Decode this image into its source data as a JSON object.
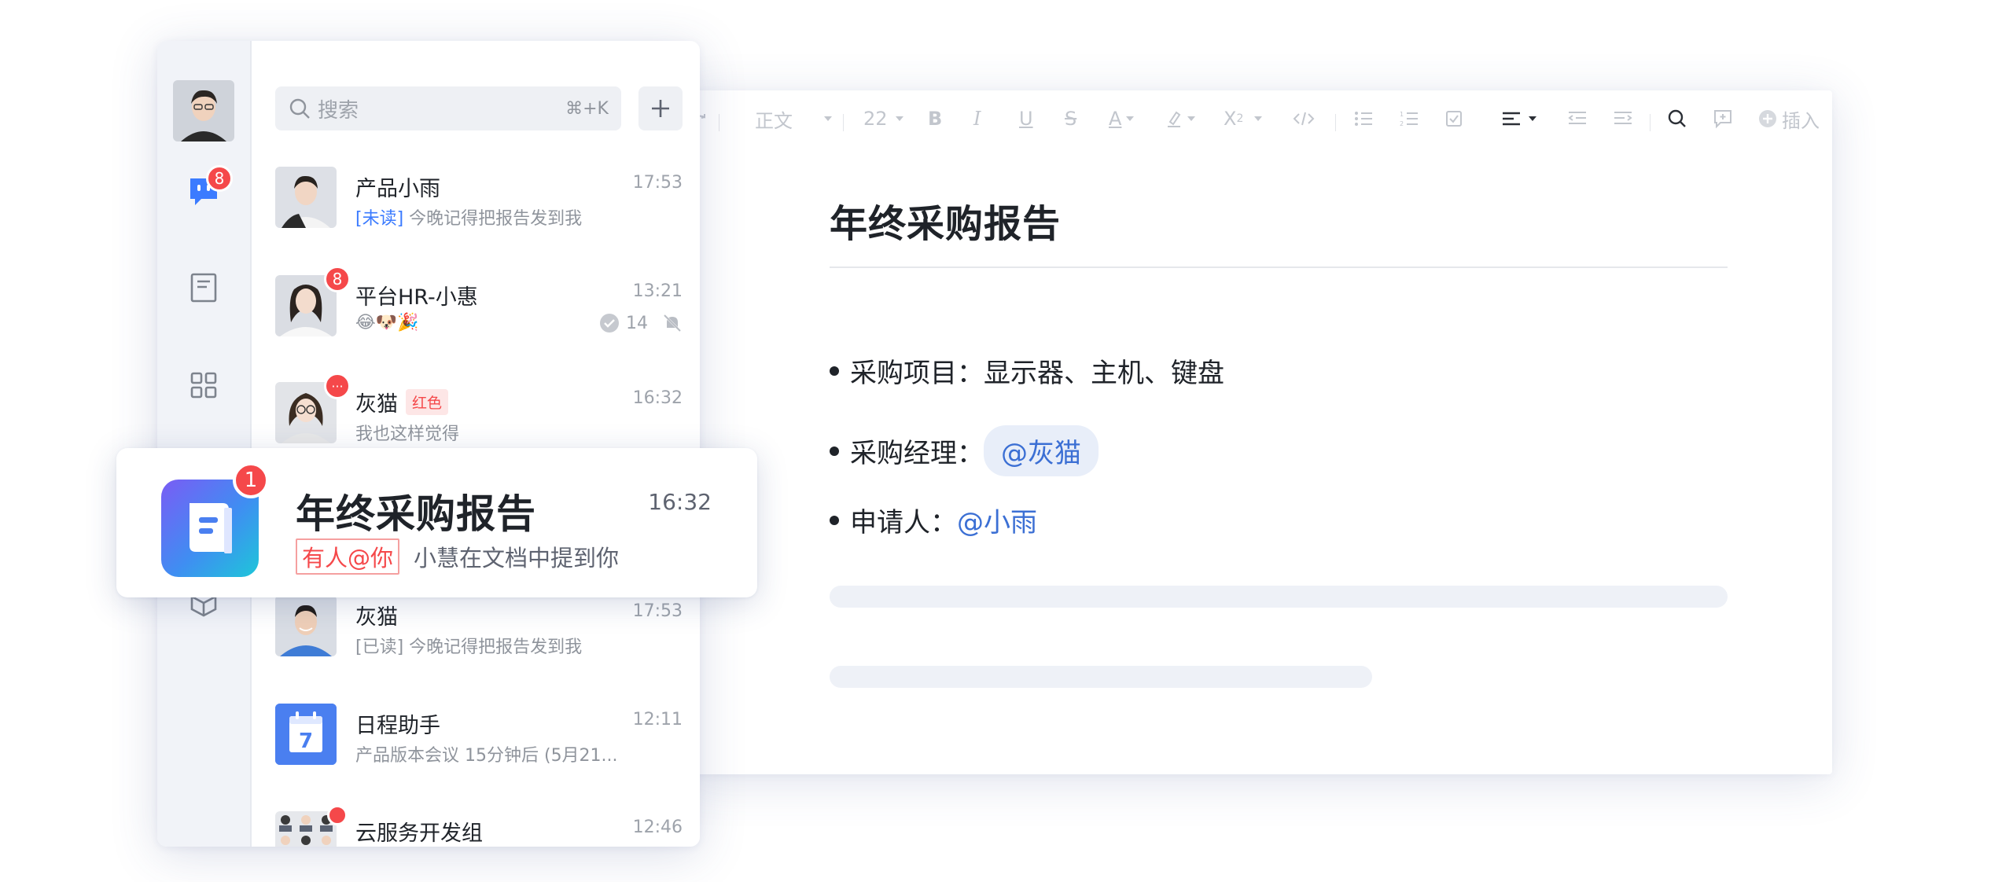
{
  "editor": {
    "toolbar": {
      "text_style": "正文",
      "font_size": "22",
      "insert_label": "插入"
    },
    "doc_title": "年终采购报告",
    "bullets": [
      {
        "label": "采购项目：",
        "value": "显示器、主机、键盘"
      },
      {
        "label": "采购经理：",
        "mention": "@灰猫"
      },
      {
        "label": "申请人：",
        "mention": "@小雨"
      }
    ]
  },
  "messenger": {
    "rail": {
      "messages_badge": "8"
    },
    "search": {
      "placeholder": "搜索",
      "shortcut": "⌘+K"
    },
    "chats": [
      {
        "name": "产品小雨",
        "time": "17:53",
        "tag": "[未读]",
        "preview": "今晚记得把报告发到我"
      },
      {
        "name": "平台HR-小惠",
        "time": "13:21",
        "preview": "😂🐶🎉",
        "read_count": "14",
        "badge": "8"
      },
      {
        "name": "灰猫",
        "label": "红色",
        "time": "16:32",
        "preview": "我也这样觉得",
        "badge": "···"
      },
      {
        "name": "灰猫",
        "time": "17:53",
        "tag": "[已读]",
        "preview": "今晚记得把报告发到我"
      },
      {
        "name": "日程助手",
        "time": "12:11",
        "preview": "产品版本会议 15分钟后 (5月21...",
        "icon_text": "7"
      },
      {
        "name": "云服务开发组",
        "time": "12:46"
      }
    ]
  },
  "notification": {
    "title": "年终采购报告",
    "time": "16:32",
    "badge": "1",
    "mention_tag": "有人@你",
    "message": "小慧在文档中提到你"
  },
  "colors": {
    "accent_blue": "#3b6fd4",
    "badge_red": "#f5484a",
    "rail_bg": "#f1f3f8"
  }
}
